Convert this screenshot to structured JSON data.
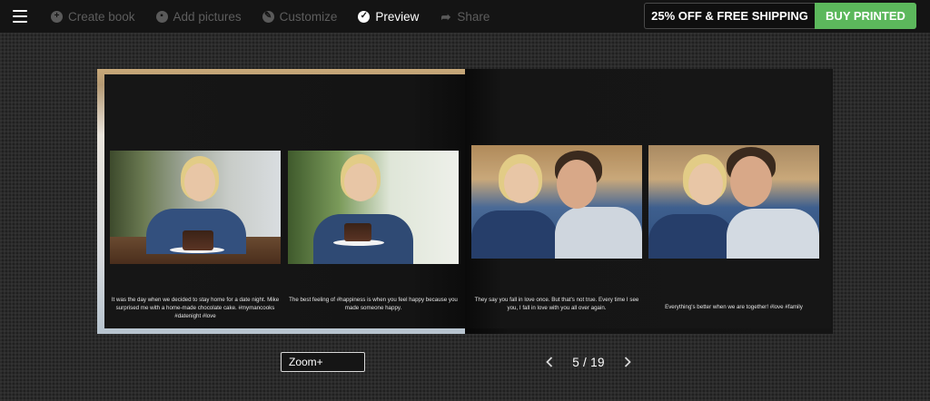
{
  "topbar": {
    "steps": [
      {
        "label": "Create book",
        "icon": "plus-circle-icon",
        "active": false
      },
      {
        "label": "Add pictures",
        "icon": "image-circle-icon",
        "active": false
      },
      {
        "label": "Customize",
        "icon": "brush-circle-icon",
        "active": false
      },
      {
        "label": "Preview",
        "icon": "check-circle-icon",
        "active": true
      },
      {
        "label": "Share",
        "icon": "share-arrow-icon",
        "active": false
      }
    ],
    "promo_text": "25% OFF & FREE SHIPPING",
    "buy_label": "BUY PRINTED",
    "buy_color": "#5cb85c"
  },
  "book": {
    "captions": [
      "It was the day when we decided to stay home for a date night. Mike surprised me with a home-made chocolate cake. #mymancooks #datenight #love",
      "The best feeling of #happiness is when you feel happy because you made someone happy.",
      "They say you fall in love once. But that's not true. Every time I see you, I fall in love with you all over again.",
      "Everything's better when we are together! #love #family"
    ]
  },
  "controls": {
    "zoom_label": "Zoom+",
    "page_indicator": "5 / 19"
  }
}
